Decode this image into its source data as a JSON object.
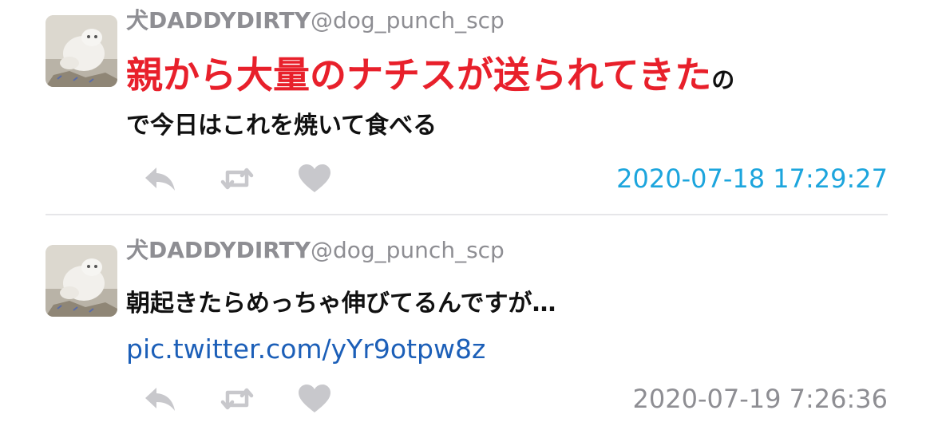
{
  "colors": {
    "highlight_red": "#e8202b",
    "link_blue": "#1c5fb8",
    "timestamp_blue": "#1ca5dd",
    "muted_gray": "#8e8e93",
    "icon_gray": "#c8c8cc"
  },
  "icons": {
    "reply": "reply-icon",
    "retweet": "retweet-icon",
    "like": "heart-icon"
  },
  "tweets": [
    {
      "display_name": "犬DADDYDIRTY",
      "handle": "@dog_punch_scp",
      "highlight_text": "親から大量のナチスが送られてきた",
      "highlight_tail": "の",
      "text_line2": "で今日はこれを焼いて食べる",
      "timestamp": "2020-07-18 17:29:27"
    },
    {
      "display_name": "犬DADDYDIRTY",
      "handle": "@dog_punch_scp",
      "text": "朝起きたらめっちゃ伸びてるんですが…",
      "link": "pic.twitter.com/yYr9otpw8z",
      "timestamp": "2020-07-19 7:26:36"
    }
  ]
}
